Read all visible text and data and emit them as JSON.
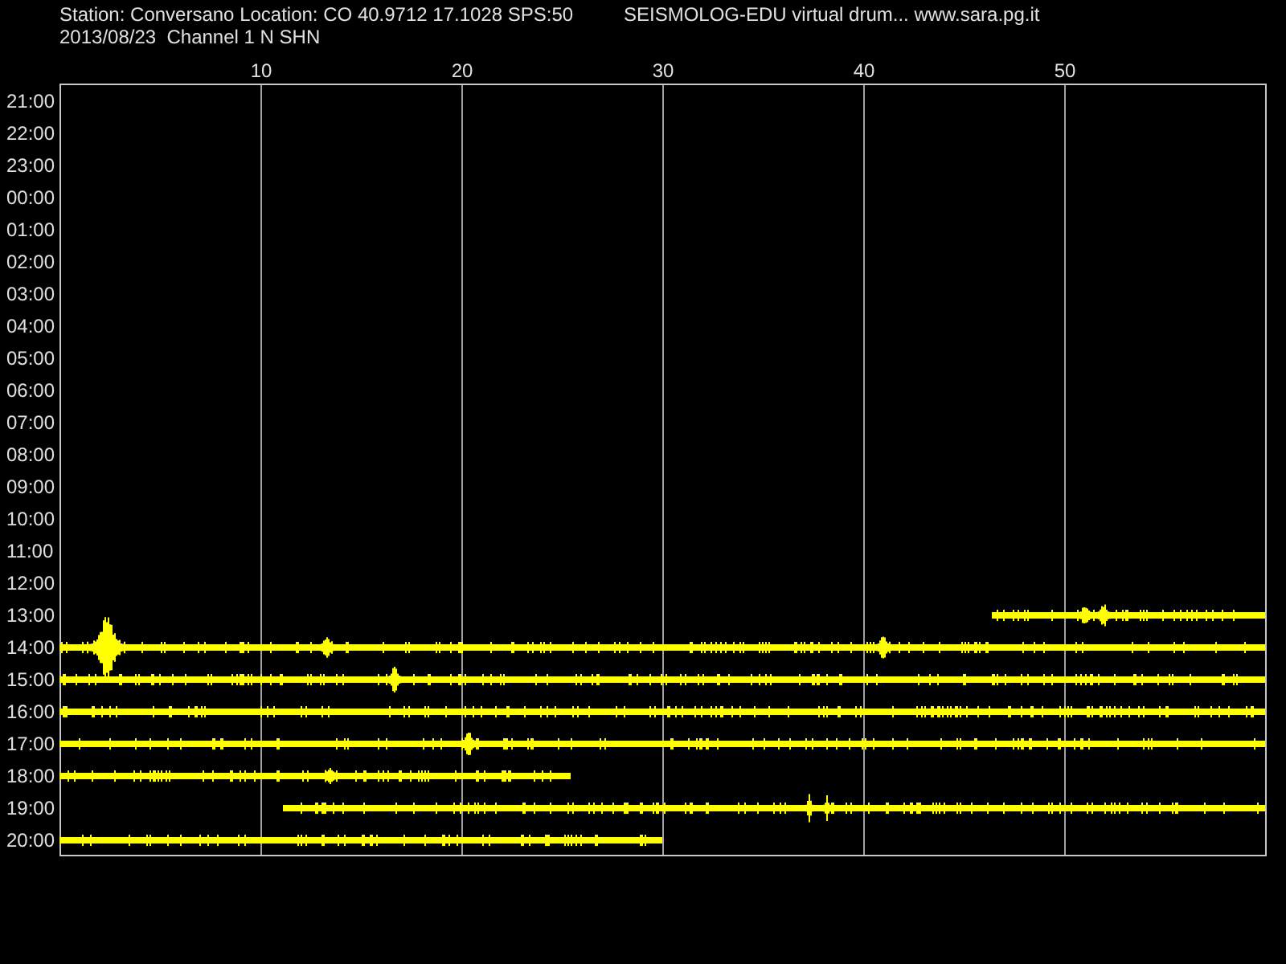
{
  "header": {
    "station_line": "Station: Conversano Location: CO 40.9712 17.1028 SPS:50",
    "title": "SEISMOLOG-EDU virtual drum... www.sara.pg.it",
    "date_line": "2013/08/23  Channel 1 N SHN"
  },
  "x_axis": {
    "labels": [
      "10",
      "20",
      "30",
      "40",
      "50"
    ]
  },
  "hour_labels": [
    "21:00",
    "22:00",
    "23:00",
    "00:00",
    "01:00",
    "02:00",
    "03:00",
    "04:00",
    "05:00",
    "06:00",
    "07:00",
    "08:00",
    "09:00",
    "10:00",
    "11:00",
    "12:00",
    "13:00",
    "14:00",
    "15:00",
    "16:00",
    "17:00",
    "18:00",
    "19:00",
    "20:00"
  ]
}
